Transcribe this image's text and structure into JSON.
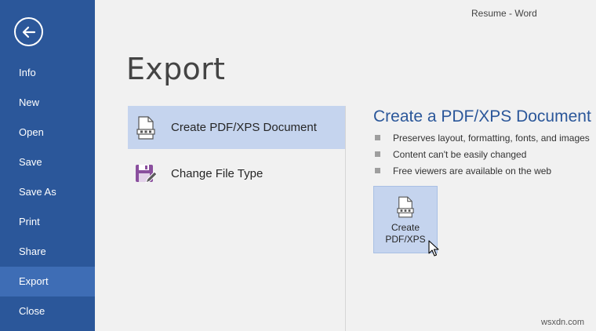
{
  "window": {
    "title": "Resume - Word"
  },
  "sidebar": {
    "back_icon": "back-arrow-icon",
    "items": [
      {
        "label": "Info",
        "active": false
      },
      {
        "label": "New",
        "active": false
      },
      {
        "label": "Open",
        "active": false
      },
      {
        "label": "Save",
        "active": false
      },
      {
        "label": "Save As",
        "active": false
      },
      {
        "label": "Print",
        "active": false
      },
      {
        "label": "Share",
        "active": false
      },
      {
        "label": "Export",
        "active": true
      },
      {
        "label": "Close",
        "active": false
      }
    ]
  },
  "main": {
    "title": "Export",
    "options": [
      {
        "label": "Create PDF/XPS Document",
        "icon": "pdf-document-icon",
        "selected": true
      },
      {
        "label": "Change File Type",
        "icon": "change-file-type-icon",
        "selected": false
      }
    ],
    "pane": {
      "heading": "Create a PDF/XPS Document",
      "bullets": [
        "Preserves layout, formatting, fonts, and images",
        "Content can't be easily changed",
        "Free viewers are available on the web"
      ],
      "button": {
        "line1": "Create",
        "line2": "PDF/XPS",
        "icon": "pdf-document-icon"
      }
    }
  },
  "watermark": "wsxdn.com",
  "colors": {
    "sidebar": "#2b579a",
    "sidebar_active": "#3e6db5",
    "selected": "#c5d4ee",
    "heading": "#2b579a",
    "background": "#f1f1f1"
  }
}
